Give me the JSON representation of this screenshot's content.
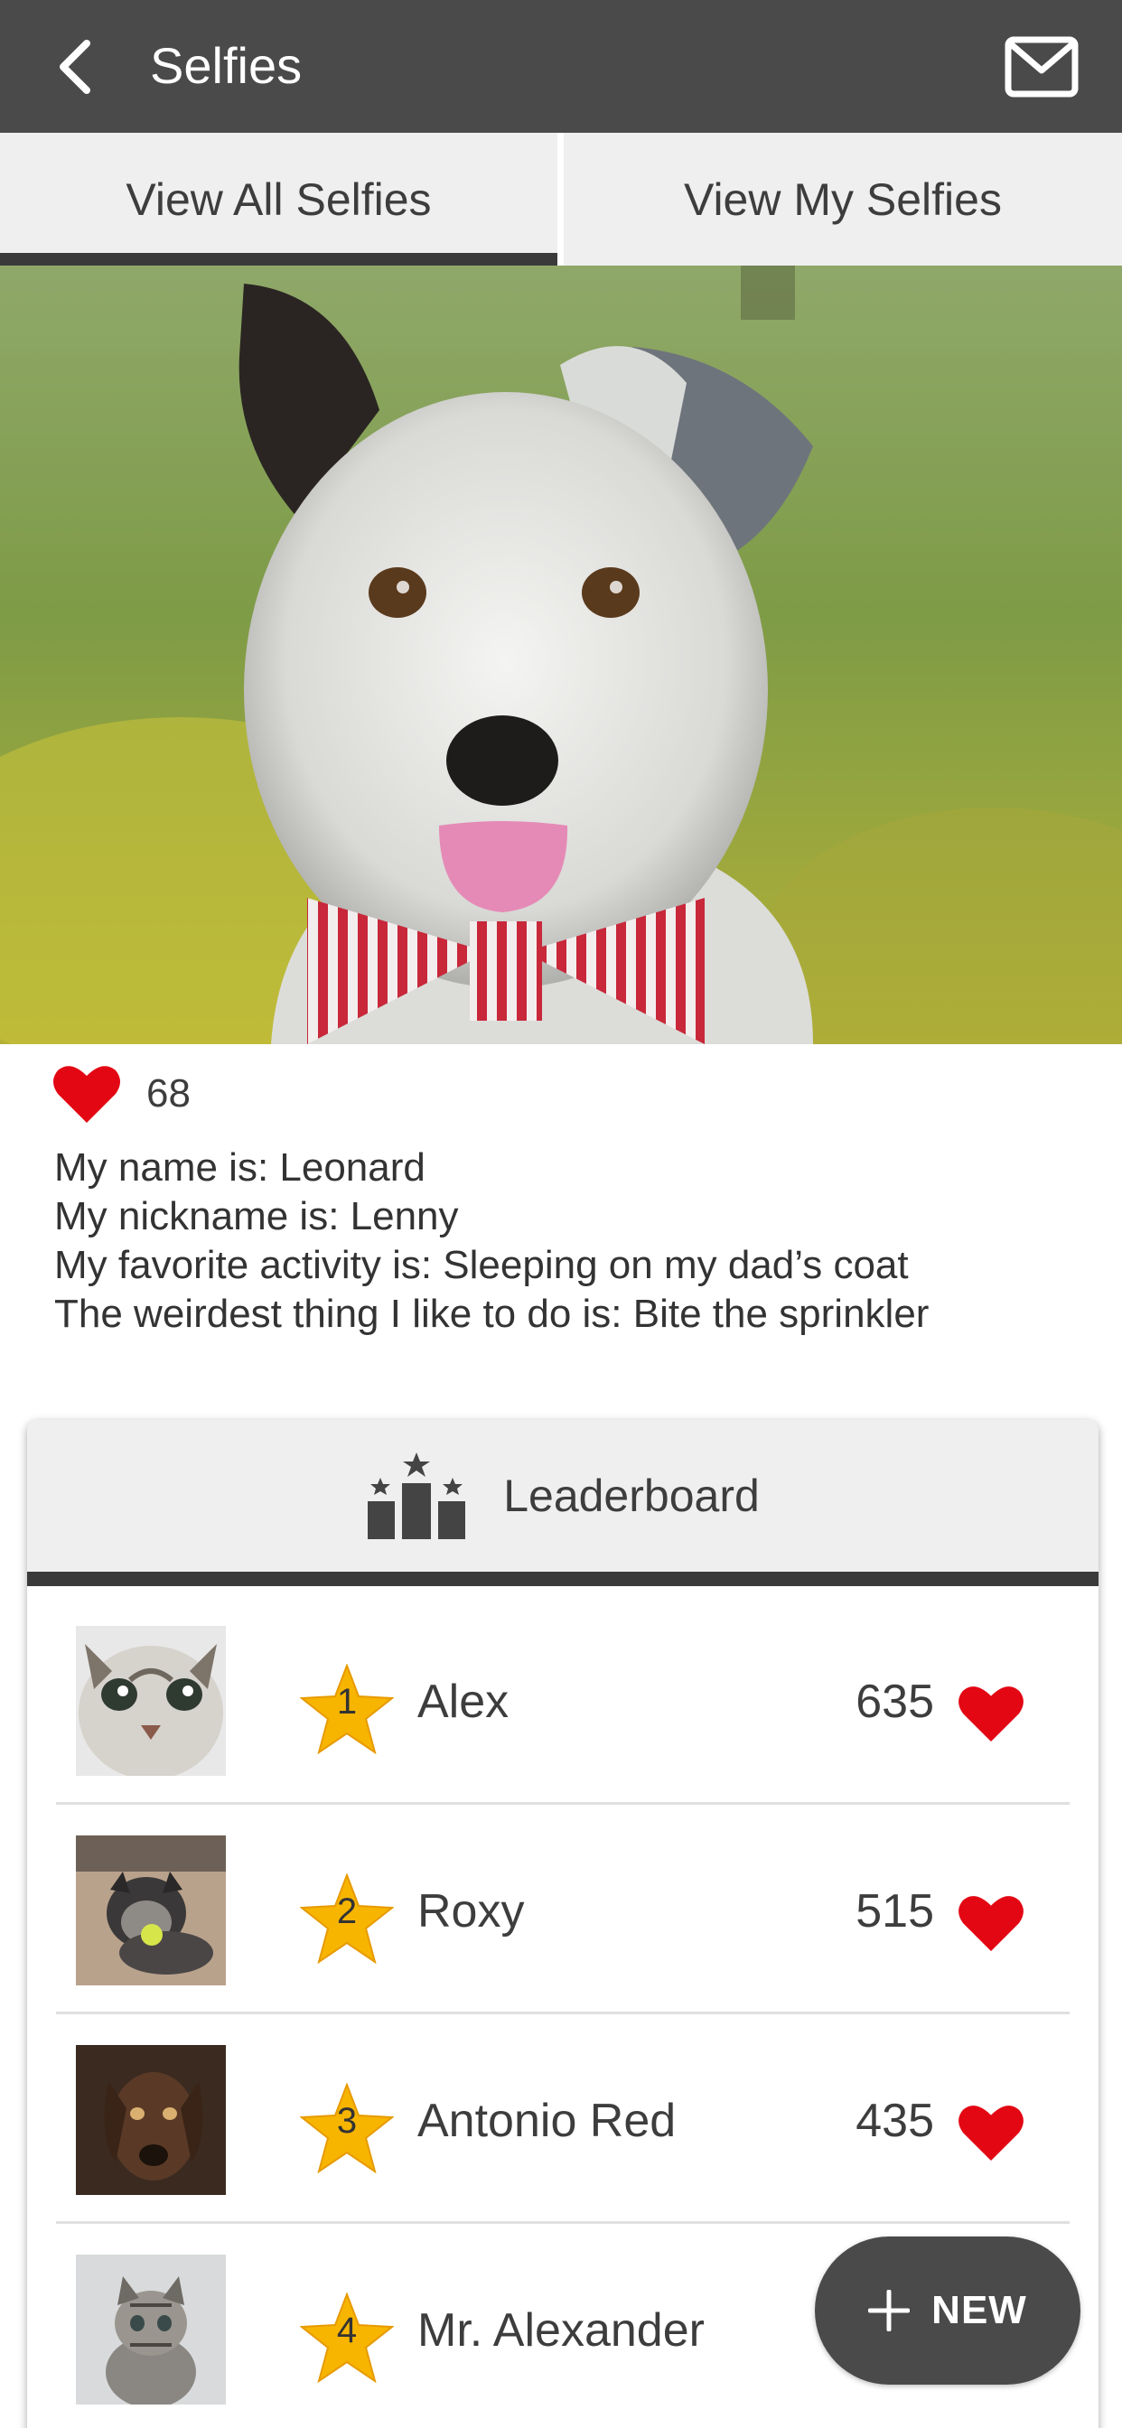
{
  "header": {
    "title": "Selfies",
    "back_icon": "chevron-left-icon",
    "mail_icon": "mail-icon"
  },
  "tabs": [
    {
      "label": "View All Selfies",
      "active": true
    },
    {
      "label": "View My Selfies",
      "active": false
    }
  ],
  "selfie": {
    "likes": "68",
    "details": [
      "My name is: Leonard",
      "My nickname is: Lenny",
      "My favorite activity is: Sleeping on my dad’s coat",
      "The weirdest thing I like to do is: Bite the sprinkler"
    ]
  },
  "leaderboard": {
    "title": "Leaderboard",
    "icon": "podium-icon",
    "entries": [
      {
        "rank": "1",
        "name": "Alex",
        "score": "635"
      },
      {
        "rank": "2",
        "name": "Roxy",
        "score": "515"
      },
      {
        "rank": "3",
        "name": "Antonio Red",
        "score": "435"
      },
      {
        "rank": "4",
        "name": "Mr. Alexander",
        "score": ""
      }
    ]
  },
  "fab": {
    "label": "NEW",
    "icon": "plus-icon"
  },
  "colors": {
    "appbar": "#4a4a4a",
    "heart": "#e30613",
    "tab_bg": "#efefef",
    "star_gold": "#f7b500"
  }
}
